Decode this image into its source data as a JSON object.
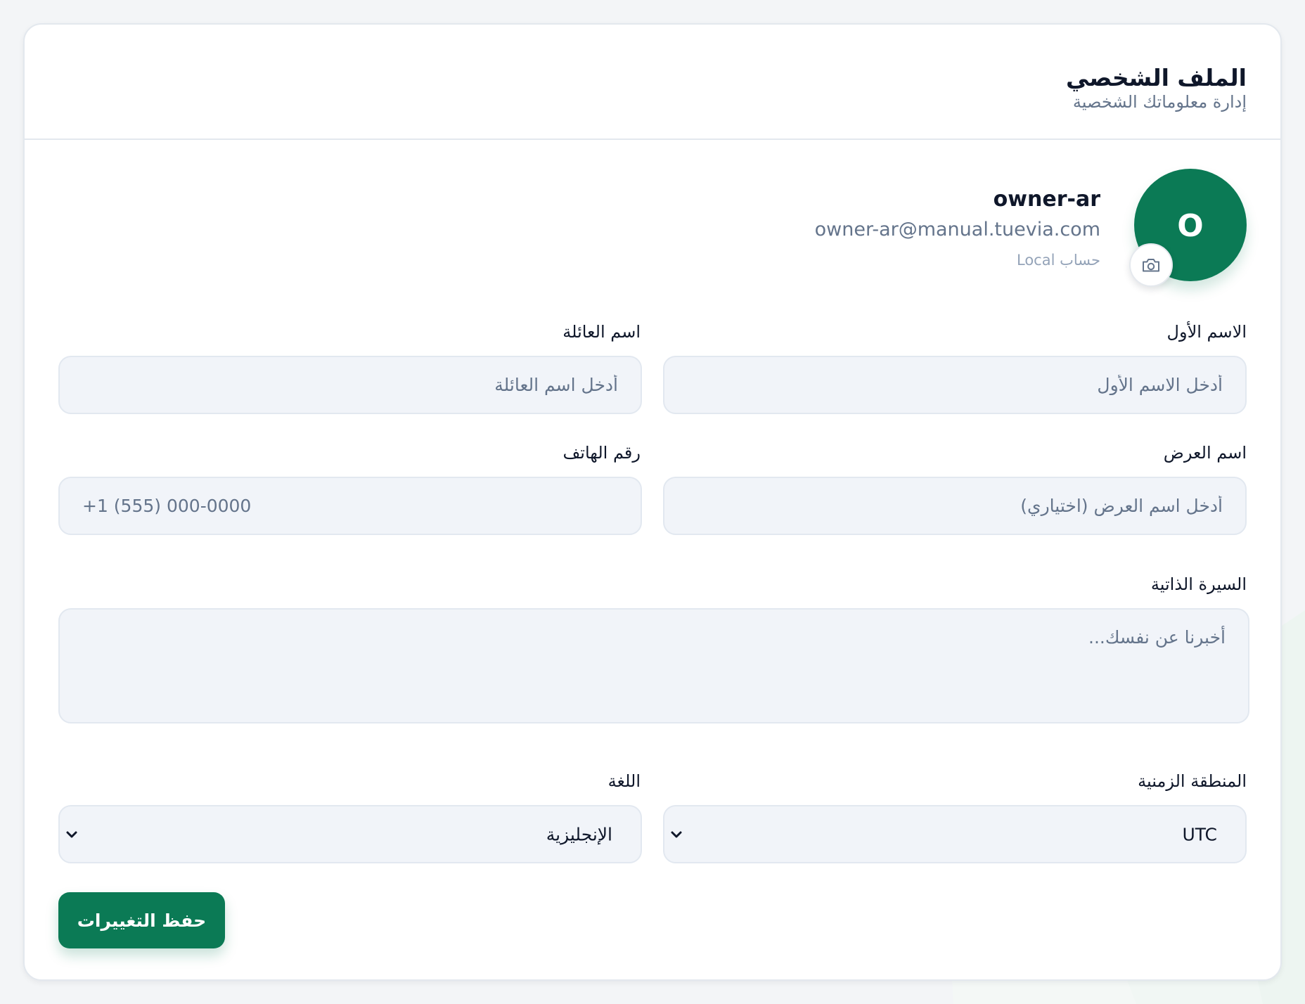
{
  "header": {
    "title": "الملف الشخصي",
    "subtitle": "إدارة معلوماتك الشخصية"
  },
  "profile": {
    "avatar_initial": "O",
    "name": "owner-ar",
    "email": "owner-ar@manual.tuevia.com",
    "account_type": "حساب Local",
    "camera_icon": "camera-icon"
  },
  "form": {
    "first_name": {
      "label": "الاسم الأول",
      "placeholder": "أدخل الاسم الأول",
      "value": ""
    },
    "last_name": {
      "label": "اسم العائلة",
      "placeholder": "أدخل اسم العائلة",
      "value": ""
    },
    "display_name": {
      "label": "اسم العرض",
      "placeholder": "أدخل اسم العرض (اختياري)",
      "value": ""
    },
    "phone": {
      "label": "رقم الهاتف",
      "placeholder": "+1 (555) 000-0000",
      "value": ""
    },
    "bio": {
      "label": "السيرة الذاتية",
      "placeholder": "أخبرنا عن نفسك...",
      "value": ""
    },
    "timezone": {
      "label": "المنطقة الزمنية",
      "value": "UTC"
    },
    "language": {
      "label": "اللغة",
      "value": "الإنجليزية"
    },
    "save_label": "حفظ التغييرات"
  },
  "colors": {
    "accent": "#0b7a55",
    "input_background": "#f1f4f9",
    "border": "#e2e8f0",
    "muted_text": "#64748b"
  }
}
